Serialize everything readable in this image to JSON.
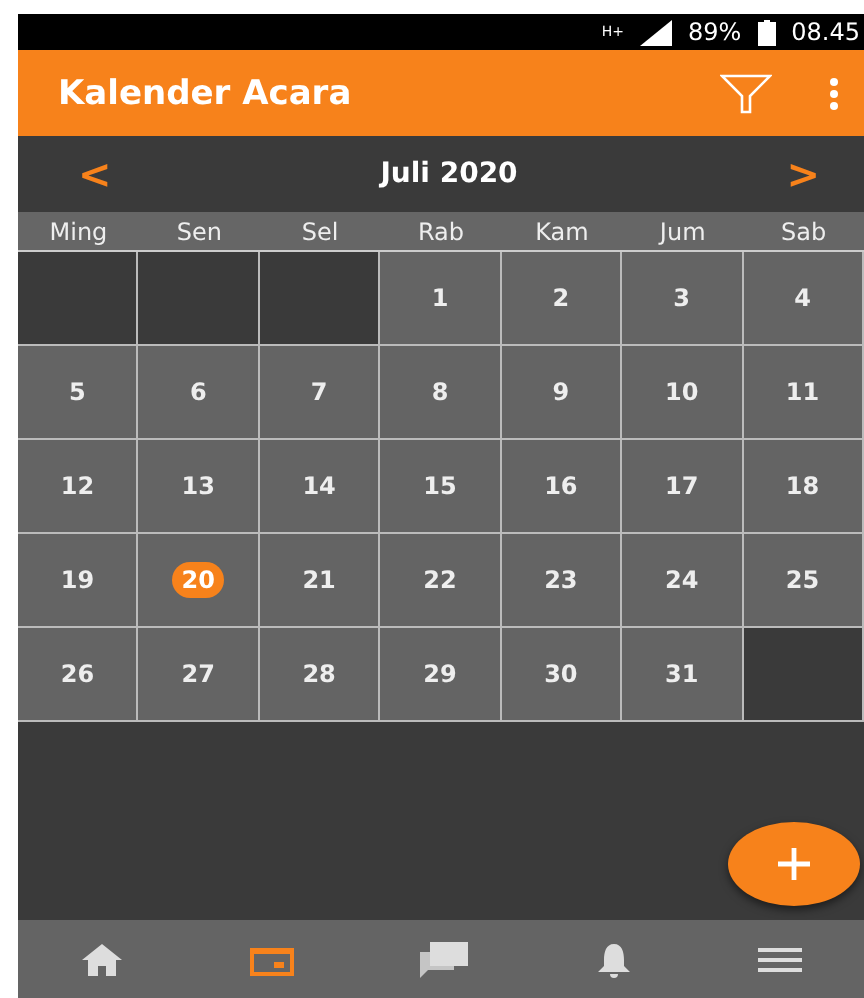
{
  "status_bar": {
    "network": "H+",
    "battery": "89%",
    "time": "08.45"
  },
  "app_bar": {
    "title": "Kalender Acara"
  },
  "month_bar": {
    "prev": "<",
    "title": "Juli 2020",
    "next": ">"
  },
  "weekdays": [
    "Ming",
    "Sen",
    "Sel",
    "Rab",
    "Kam",
    "Jum",
    "Sab"
  ],
  "days": [
    {
      "kind": "empty"
    },
    {
      "kind": "empty"
    },
    {
      "kind": "empty"
    },
    {
      "kind": "day",
      "label": "1",
      "selected": false
    },
    {
      "kind": "day",
      "label": "2",
      "selected": false
    },
    {
      "kind": "day",
      "label": "3",
      "selected": false
    },
    {
      "kind": "day",
      "label": "4",
      "selected": false
    },
    {
      "kind": "day",
      "label": "5",
      "selected": false
    },
    {
      "kind": "day",
      "label": "6",
      "selected": false
    },
    {
      "kind": "day",
      "label": "7",
      "selected": false
    },
    {
      "kind": "day",
      "label": "8",
      "selected": false
    },
    {
      "kind": "day",
      "label": "9",
      "selected": false
    },
    {
      "kind": "day",
      "label": "10",
      "selected": false
    },
    {
      "kind": "day",
      "label": "11",
      "selected": false
    },
    {
      "kind": "day",
      "label": "12",
      "selected": false
    },
    {
      "kind": "day",
      "label": "13",
      "selected": false
    },
    {
      "kind": "day",
      "label": "14",
      "selected": false
    },
    {
      "kind": "day",
      "label": "15",
      "selected": false
    },
    {
      "kind": "day",
      "label": "16",
      "selected": false
    },
    {
      "kind": "day",
      "label": "17",
      "selected": false
    },
    {
      "kind": "day",
      "label": "18",
      "selected": false
    },
    {
      "kind": "day",
      "label": "19",
      "selected": false
    },
    {
      "kind": "day",
      "label": "20",
      "selected": true
    },
    {
      "kind": "day",
      "label": "21",
      "selected": false
    },
    {
      "kind": "day",
      "label": "22",
      "selected": false
    },
    {
      "kind": "day",
      "label": "23",
      "selected": false
    },
    {
      "kind": "day",
      "label": "24",
      "selected": false
    },
    {
      "kind": "day",
      "label": "25",
      "selected": false
    },
    {
      "kind": "day",
      "label": "26",
      "selected": false
    },
    {
      "kind": "day",
      "label": "27",
      "selected": false
    },
    {
      "kind": "day",
      "label": "28",
      "selected": false
    },
    {
      "kind": "day",
      "label": "29",
      "selected": false
    },
    {
      "kind": "day",
      "label": "30",
      "selected": false
    },
    {
      "kind": "day",
      "label": "31",
      "selected": false
    },
    {
      "kind": "empty"
    }
  ],
  "nav": [
    {
      "kind": "home",
      "selected": false
    },
    {
      "kind": "calendar",
      "selected": true
    },
    {
      "kind": "chat",
      "selected": false
    },
    {
      "kind": "bell",
      "selected": false
    },
    {
      "kind": "menu",
      "selected": false
    }
  ]
}
